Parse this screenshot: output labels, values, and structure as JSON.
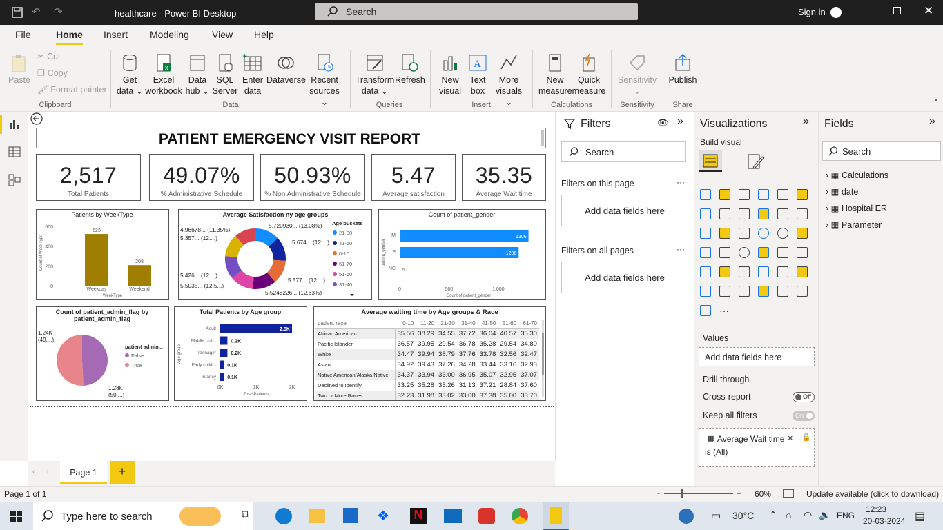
{
  "window": {
    "title": "healthcare - Power BI Desktop",
    "search_placeholder": "Search",
    "signin": "Sign in"
  },
  "menu": [
    "File",
    "Home",
    "Insert",
    "Modeling",
    "View",
    "Help"
  ],
  "ribbon": {
    "clipboard": {
      "paste": "Paste",
      "cut": "Cut",
      "copy": "Copy",
      "format_painter": "Format painter",
      "group": "Clipboard"
    },
    "data": {
      "get_data": [
        "Get",
        "data ⌄"
      ],
      "excel": [
        "Excel",
        "workbook"
      ],
      "data_hub": [
        "Data",
        "hub ⌄"
      ],
      "sql": [
        "SQL",
        "Server"
      ],
      "enter": [
        "Enter",
        "data"
      ],
      "dataverse": [
        "Dataverse",
        ""
      ],
      "recent": [
        "Recent",
        "sources ⌄"
      ],
      "group": "Data"
    },
    "queries": {
      "transform": [
        "Transform",
        "data ⌄"
      ],
      "refresh": [
        "Refresh",
        ""
      ],
      "group": "Queries"
    },
    "insert": {
      "new_visual": [
        "New",
        "visual"
      ],
      "text_box": [
        "Text",
        "box"
      ],
      "more_visuals": [
        "More",
        "visuals ⌄"
      ],
      "group": "Insert"
    },
    "calculations": {
      "new_measure": [
        "New",
        "measure"
      ],
      "quick_measure": [
        "Quick",
        "measure"
      ],
      "group": "Calculations"
    },
    "sensitivity": {
      "label": [
        "Sensitivity",
        "⌄"
      ],
      "group": "Sensitivity"
    },
    "share": {
      "publish": [
        "Publish",
        ""
      ],
      "group": "Share"
    }
  },
  "report": {
    "title": "PATIENT EMERGENCY VISIT REPORT",
    "kpis": [
      {
        "value": "2,517",
        "label": "Total Patients"
      },
      {
        "value": "49.07%",
        "label": "% Administrative Schedule"
      },
      {
        "value": "50.93%",
        "label": "% Non Administrative Schedule"
      },
      {
        "value": "5.47",
        "label": "Average satisfaction"
      },
      {
        "value": "35.35",
        "label": "Average Wait time"
      }
    ]
  },
  "chart_data": [
    {
      "type": "bar",
      "title": "Patients by WeekType",
      "categories": [
        "Weekday",
        "Weekend"
      ],
      "values": [
        523,
        208
      ],
      "xlabel": "WeekType",
      "ylabel": "Count of WeekType",
      "ylim": [
        0,
        600
      ],
      "yticks": [
        "600",
        "400",
        "200",
        "0"
      ],
      "data_labels": [
        "523",
        "208"
      ],
      "color": "#a07f00"
    },
    {
      "type": "pie",
      "title": "Average Satisfaction ny age groups",
      "legend_title": "Age buckets",
      "slices": [
        {
          "name": "21-30",
          "value": 5.72,
          "label": "5.720930... (13.08%)",
          "color": "#118dff"
        },
        {
          "name": "41-50",
          "value": 5.674,
          "label": "5.674... (12....)",
          "color": "#12239e"
        },
        {
          "name": "0-10",
          "value": 5.577,
          "label": "5.577... (12....)",
          "color": "#e66c37"
        },
        {
          "name": "61-70",
          "value": 5.5248,
          "label": "5.5248226... (12.63%)",
          "color": "#6b007b"
        },
        {
          "name": "51-60",
          "value": 5.5035,
          "label": "5.5035... (12.5...)",
          "color": "#e044a7"
        },
        {
          "name": "31-40",
          "value": 5.426,
          "label": "5.426... (12....)",
          "color": "#744ec2"
        },
        {
          "name": "",
          "value": 5.357,
          "label": "5.357... (12....)",
          "color": "#d9b300"
        },
        {
          "name": "",
          "value": 4.9668,
          "label": "4.96678... (11.35%)",
          "color": "#d64550"
        }
      ]
    },
    {
      "type": "bar",
      "title": "Count of patient_gender",
      "orientation": "horizontal",
      "categories": [
        "M",
        "F",
        "NC"
      ],
      "values": [
        1306,
        1206,
        5
      ],
      "data_labels": [
        "1306",
        "1206",
        "5"
      ],
      "xlabel": "Count of patient_gender",
      "ylabel": "patient_gender",
      "xlim": [
        0,
        1400
      ],
      "xticks": [
        "0",
        "500",
        "1,000"
      ],
      "color": "#118dff"
    },
    {
      "type": "pie",
      "title": "Count of patient_admin_flag by patient_admin_flag",
      "legend_title": "patient admin...",
      "slices": [
        {
          "name": "False",
          "value": 1240,
          "label": "1.24K (49....)",
          "color": "#a66ab4"
        },
        {
          "name": "True",
          "value": 1280,
          "label": "1.28K (50....)",
          "color": "#e8858b"
        }
      ]
    },
    {
      "type": "bar",
      "title": "Total Patients by Age group",
      "orientation": "horizontal",
      "categories": [
        "Adult",
        "Middle chil...",
        "Teenager",
        "Early child...",
        "Infancy"
      ],
      "values": [
        2000,
        200,
        200,
        100,
        100
      ],
      "data_labels": [
        "2.0K",
        "0.2K",
        "0.2K",
        "0.1K",
        "0.1K"
      ],
      "xlabel": "Total Patients",
      "ylabel": "Age group",
      "xlim": [
        0,
        2000
      ],
      "xticks": [
        "0K",
        "1K",
        "2K"
      ],
      "color": "#12239e"
    },
    {
      "type": "table",
      "title": "Average waiting time by Age groups & Race",
      "columns": [
        "patient race",
        "0-10",
        "11-20",
        "21-30",
        "31-40",
        "41-50",
        "51-60",
        "61-70"
      ],
      "rows": [
        [
          "African American",
          "35.56",
          "38.29",
          "34.55",
          "37.72",
          "36.04",
          "40.57",
          "35.30"
        ],
        [
          "Pacific Islander",
          "36.57",
          "39.95",
          "29.54",
          "36.78",
          "35.28",
          "29.54",
          "34.80"
        ],
        [
          "White",
          "34.47",
          "39.94",
          "38.79",
          "37.76",
          "33.78",
          "32.56",
          "32.47"
        ],
        [
          "Asian",
          "34.92",
          "39.43",
          "37.26",
          "34.28",
          "33.44",
          "33.16",
          "32.93"
        ],
        [
          "Native American/Alaska Native",
          "34.37",
          "33.94",
          "33.00",
          "36.95",
          "35.07",
          "32.95",
          "37.07"
        ],
        [
          "Declined to Identify",
          "33.25",
          "35.28",
          "35.26",
          "31.13",
          "37.21",
          "28.84",
          "37.60"
        ],
        [
          "Two or More Races",
          "32.23",
          "31.98",
          "33.02",
          "33.00",
          "37.38",
          "35.00",
          "33.70"
        ]
      ]
    }
  ],
  "filters": {
    "title": "Filters",
    "search": "Search",
    "on_page": "Filters on this page",
    "on_all": "Filters on all pages",
    "add_here": "Add data fields here",
    "more": "···"
  },
  "visualizations": {
    "title": "Visualizations",
    "build": "Build visual",
    "values": "Values",
    "add_here": "Add data fields here",
    "drill": "Drill through",
    "cross_report": "Cross-report",
    "cross_state": "Off",
    "keep_filters": "Keep all filters",
    "keep_state": "On",
    "filter_chip": "Average Wait time",
    "filter_chip_sub": "is (All)",
    "more": "···"
  },
  "fields": {
    "title": "Fields",
    "search": "Search",
    "tables": [
      "Calculations",
      "date",
      "Hospital ER",
      "Parameter"
    ]
  },
  "pages": {
    "tab": "Page 1",
    "add": "+"
  },
  "status": {
    "page": "Page 1 of 1",
    "zoom": "60%",
    "update": "Update available (click to download)",
    "minus": "-",
    "plus": "+"
  },
  "taskbar": {
    "search": "Type here to search",
    "temp": "30°C",
    "lang": "ENG",
    "time": "12:23",
    "date": "20-03-2024"
  }
}
